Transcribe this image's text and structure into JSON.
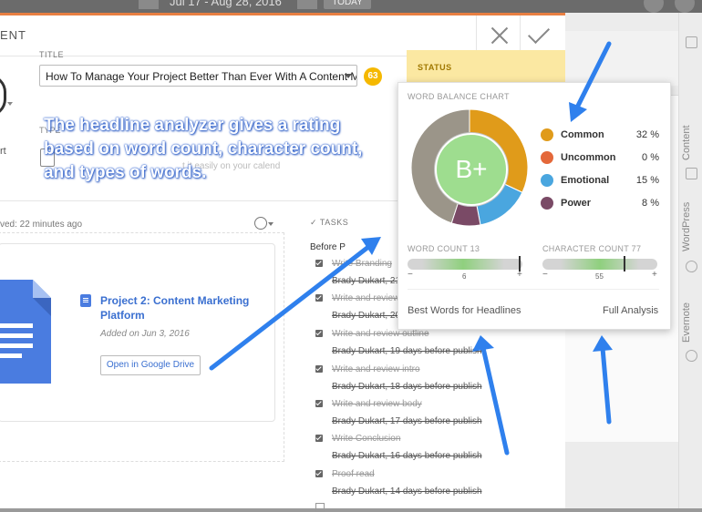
{
  "topbar": {
    "date_range": "Jul 17 - Aug 28, 2016",
    "today_label": "TODAY"
  },
  "modal": {
    "header_title": "ENT",
    "title_label": "TITLE",
    "title_value": "How To Manage Your Project Better Than Ever With A Content Ma",
    "headline_score": "63",
    "type_label": "TYPE",
    "type_text": "rt",
    "faded_text": "t it easily on your calend",
    "saved_text": "ved: 22 minutes ago"
  },
  "attachment": {
    "project_title": "Project 2: Content Marketing Platform",
    "added_text": "Added on Jun 3, 2016",
    "open_button": "Open in Google Drive"
  },
  "tasks": {
    "header": "TASKS",
    "group_label": "Before P",
    "items": [
      {
        "name": "Write Branding",
        "assignee": "Brady Dukart, 21"
      },
      {
        "name": "Write and review",
        "assignee": "Brady Dukart, 20"
      },
      {
        "name": "Write and review outline",
        "assignee": "Brady Dukart, 19 days before publish"
      },
      {
        "name": "Write and review intro",
        "assignee": "Brady Dukart, 18 days before publish"
      },
      {
        "name": "Write and review body",
        "assignee": "Brady Dukart, 17 days before publish"
      },
      {
        "name": "Write Conclusion",
        "assignee": "Brady Dukart, 16 days before publish"
      },
      {
        "name": "Proof read",
        "assignee": "Brady Dukart, 14 days before publish"
      }
    ]
  },
  "status": {
    "label": "STATUS"
  },
  "word_balance": {
    "title": "WORD BALANCE CHART",
    "grade": "B+",
    "legend": [
      {
        "name": "Common",
        "percent": "32 %",
        "value": 32,
        "color": "#e09b1a"
      },
      {
        "name": "Uncommon",
        "percent": "0 %",
        "value": 0,
        "color": "#e4683a"
      },
      {
        "name": "Emotional",
        "percent": "15 %",
        "value": 15,
        "color": "#4aa6df"
      },
      {
        "name": "Power",
        "percent": "8 %",
        "value": 8,
        "color": "#7a4a66"
      }
    ],
    "other_color": "#9b9589",
    "word_count_label": "WORD COUNT 13",
    "word_count_scale_value": "6",
    "char_count_label": "CHARACTER COUNT 77",
    "char_count_scale_value": "55",
    "minus": "−",
    "plus": "+",
    "link_best_words": "Best Words for Headlines",
    "link_full_analysis": "Full Analysis"
  },
  "sidebar_right": {
    "labels": [
      "Content",
      "WordPress",
      "Evernote"
    ]
  },
  "annotation": {
    "text": "The headline analyzer gives a rating based on word count, character count, and types of words."
  }
}
